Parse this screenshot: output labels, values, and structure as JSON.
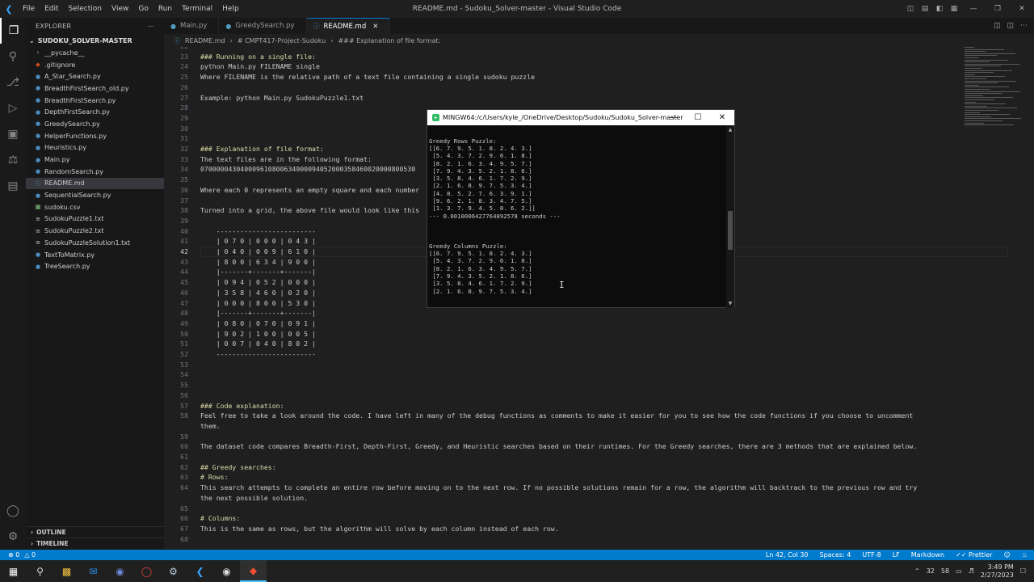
{
  "window": {
    "title": "README.md - Sudoku_Solver-master - Visual Studio Code"
  },
  "menu": [
    "File",
    "Edit",
    "Selection",
    "View",
    "Go",
    "Run",
    "Terminal",
    "Help"
  ],
  "sidebar": {
    "header": "EXPLORER",
    "project": "SUDOKU_SOLVER-MASTER",
    "files": [
      {
        "name": "__pycache__",
        "icon": "chevron-right-icon",
        "kind": "folder"
      },
      {
        "name": ".gitignore",
        "icon": "git-icon",
        "kind": "git"
      },
      {
        "name": "A_Star_Search.py",
        "icon": "python-icon",
        "kind": "py"
      },
      {
        "name": "BreadthFirstSearch_old.py",
        "icon": "python-icon",
        "kind": "py"
      },
      {
        "name": "BreadthFirstSearch.py",
        "icon": "python-icon",
        "kind": "py"
      },
      {
        "name": "DepthFirstSearch.py",
        "icon": "python-icon",
        "kind": "py"
      },
      {
        "name": "GreedySearch.py",
        "icon": "python-icon",
        "kind": "py"
      },
      {
        "name": "HelperFunctions.py",
        "icon": "python-icon",
        "kind": "py"
      },
      {
        "name": "Heuristics.py",
        "icon": "python-icon",
        "kind": "py"
      },
      {
        "name": "Main.py",
        "icon": "python-icon",
        "kind": "py"
      },
      {
        "name": "RandomSearch.py",
        "icon": "python-icon",
        "kind": "py"
      },
      {
        "name": "README.md",
        "icon": "info-icon",
        "kind": "md"
      },
      {
        "name": "SequentialSearch.py",
        "icon": "python-icon",
        "kind": "py"
      },
      {
        "name": "sudoku.csv",
        "icon": "table-icon",
        "kind": "csv"
      },
      {
        "name": "SudokuPuzzle1.txt",
        "icon": "text-file-icon",
        "kind": "txt"
      },
      {
        "name": "SudokuPuzzle2.txt",
        "icon": "text-file-icon",
        "kind": "txt"
      },
      {
        "name": "SudokuPuzzleSolution1.txt",
        "icon": "text-file-icon",
        "kind": "txt"
      },
      {
        "name": "TextToMatrix.py",
        "icon": "python-icon",
        "kind": "py"
      },
      {
        "name": "TreeSearch.py",
        "icon": "python-icon",
        "kind": "py"
      }
    ],
    "outline": "OUTLINE",
    "timeline": "TIMELINE"
  },
  "tabs": [
    {
      "label": "Main.py",
      "active": false
    },
    {
      "label": "GreedySearch.py",
      "active": false
    },
    {
      "label": "README.md",
      "active": true
    }
  ],
  "breadcrumb": [
    "README.md",
    "# CMPT417-Project-Sudoku",
    "### Explanation of file format:"
  ],
  "editor": {
    "current_line": 42,
    "lines": [
      {
        "n": "22",
        "t": "",
        "s": ""
      },
      {
        "n": "23",
        "t": "### Running on a single file:",
        "s": "h"
      },
      {
        "n": "24",
        "t": "python Main.py FILENAME single",
        "s": ""
      },
      {
        "n": "25",
        "t": "Where FILENAME is the relative path of a text file containing a single sudoku puzzle",
        "s": ""
      },
      {
        "n": "26",
        "t": "",
        "s": ""
      },
      {
        "n": "27",
        "t": "Example: python Main.py SudokuPuzzle1.txt",
        "s": ""
      },
      {
        "n": "28",
        "t": "",
        "s": ""
      },
      {
        "n": "29",
        "t": "",
        "s": ""
      },
      {
        "n": "30",
        "t": "",
        "s": ""
      },
      {
        "n": "31",
        "t": "",
        "s": ""
      },
      {
        "n": "32",
        "t": "### Explanation of file format:",
        "s": "h"
      },
      {
        "n": "33",
        "t": "The text files are in the following format:",
        "s": ""
      },
      {
        "n": "34",
        "t": "070000043040009610800634900094052000358460020000800530",
        "s": ""
      },
      {
        "n": "35",
        "t": "",
        "s": ""
      },
      {
        "n": "36",
        "t": "Where each 0 represents an empty square and each number",
        "s": ""
      },
      {
        "n": "37",
        "t": "",
        "s": ""
      },
      {
        "n": "38",
        "t": "Turned into a grid, the above file would look like this",
        "s": ""
      },
      {
        "n": "39",
        "t": "",
        "s": ""
      },
      {
        "n": "40",
        "t": "    -------------------------",
        "s": ""
      },
      {
        "n": "41",
        "t": "    | 0 7 0 | 0 0 0 | 0 4 3 |",
        "s": ""
      },
      {
        "n": "42",
        "t": "    | 0 4 0 | 0 0 9 | 6 1 0 |",
        "s": ""
      },
      {
        "n": "43",
        "t": "    | 8 0 0 | 6 3 4 | 9 0 0 |",
        "s": ""
      },
      {
        "n": "44",
        "t": "    |-------+-------+-------|",
        "s": ""
      },
      {
        "n": "45",
        "t": "    | 0 9 4 | 0 5 2 | 0 0 0 |",
        "s": ""
      },
      {
        "n": "46",
        "t": "    | 3 5 8 | 4 6 0 | 0 2 0 |",
        "s": ""
      },
      {
        "n": "47",
        "t": "    | 0 0 0 | 8 0 0 | 5 3 0 |",
        "s": ""
      },
      {
        "n": "48",
        "t": "    |-------+-------+-------|",
        "s": ""
      },
      {
        "n": "49",
        "t": "    | 0 8 0 | 0 7 0 | 0 9 1 |",
        "s": ""
      },
      {
        "n": "50",
        "t": "    | 9 0 2 | 1 0 0 | 0 0 5 |",
        "s": ""
      },
      {
        "n": "51",
        "t": "    | 0 0 7 | 0 4 0 | 8 0 2 |",
        "s": ""
      },
      {
        "n": "52",
        "t": "    -------------------------",
        "s": ""
      },
      {
        "n": "53",
        "t": "",
        "s": ""
      },
      {
        "n": "54",
        "t": "",
        "s": ""
      },
      {
        "n": "55",
        "t": "",
        "s": ""
      },
      {
        "n": "56",
        "t": "",
        "s": ""
      },
      {
        "n": "57",
        "t": "### Code explanation:",
        "s": "h"
      },
      {
        "n": "58",
        "t": "Feel free to take a look around the code. I have left in many of the debug functions as comments to make it easier for you to see how the code functions if you choose to uncomment",
        "s": ""
      },
      {
        "n": "",
        "t": "them.",
        "s": ""
      },
      {
        "n": "59",
        "t": "",
        "s": ""
      },
      {
        "n": "60",
        "t": "The dataset code compares Breadth-First, Depth-First, Greedy, and Heuristic searches based on their runtimes. For the Greedy searches, there are 3 methods that are explained below.",
        "s": ""
      },
      {
        "n": "61",
        "t": "",
        "s": ""
      },
      {
        "n": "62",
        "t": "## Greedy searches:",
        "s": "h"
      },
      {
        "n": "63",
        "t": "# Rows:",
        "s": "h"
      },
      {
        "n": "64",
        "t": "This search attempts to complete an entire row before moving on to the next row. If no possible solutions remain for a row, the algorithm will backtrack to the previous row and try",
        "s": ""
      },
      {
        "n": "",
        "t": "the next possible solution.",
        "s": ""
      },
      {
        "n": "65",
        "t": "",
        "s": ""
      },
      {
        "n": "66",
        "t": "# Columns:",
        "s": "h"
      },
      {
        "n": "67",
        "t": "This is the same as rows, but the algorithm will solve by each column instead of each row.",
        "s": ""
      },
      {
        "n": "68",
        "t": "",
        "s": ""
      }
    ]
  },
  "terminal": {
    "title": "MINGW64:/c/Users/kyle_/OneDrive/Desktop/Sudoku/Sudoku_Solver-master",
    "lines": [
      "",
      "",
      "Greedy Rows Puzzle:",
      "[[6. 7. 9. 5. 1. 8. 2. 4. 3.]",
      " [5. 4. 3. 7. 2. 9. 6. 1. 8.]",
      " [8. 2. 1. 6. 3. 4. 9. 5. 7.]",
      " [7. 9. 4. 3. 5. 2. 1. 8. 6.]",
      " [3. 5. 8. 4. 6. 1. 7. 2. 9.]",
      " [2. 1. 6. 8. 9. 7. 5. 3. 4.]",
      " [4. 8. 5. 2. 7. 6. 3. 9. 1.]",
      " [9. 6. 2. 1. 8. 3. 4. 7. 5.]",
      " [1. 3. 7. 9. 4. 5. 8. 6. 2.]]",
      "--- 0.0010006427764892578 seconds ---",
      "",
      "",
      "",
      "Greedy Columns Puzzle:",
      "[[6. 7. 9. 5. 1. 8. 2. 4. 3.]",
      " [5. 4. 3. 7. 2. 9. 6. 1. 8.]",
      " [8. 2. 1. 6. 3. 4. 9. 5. 7.]",
      " [7. 9. 4. 3. 5. 2. 1. 8. 6.]",
      " [3. 5. 8. 4. 6. 1. 7. 2. 9.]",
      " [2. 1. 6. 8. 9. 7. 5. 3. 4.]"
    ]
  },
  "status": {
    "errors": "0",
    "warnings": "0",
    "position": "Ln 42, Col 30",
    "spaces": "Spaces: 4",
    "encoding": "UTF-8",
    "eol": "LF",
    "language": "Markdown",
    "prettier": "Prettier"
  },
  "taskbar": {
    "temp": "32",
    "time": "3:49 PM",
    "date": "2/27/2023",
    "badge": "58"
  },
  "colors": {
    "accent": "#007acc",
    "header": "#dcdcaa",
    "editor_bg": "#1f1f1f"
  }
}
